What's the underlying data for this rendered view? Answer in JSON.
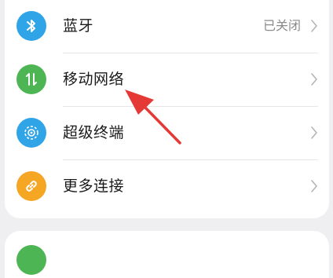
{
  "settings": {
    "items": [
      {
        "label": "蓝牙",
        "value": "已关闭",
        "icon": "bluetooth-icon",
        "color": "#2fa5e8"
      },
      {
        "label": "移动网络",
        "value": "",
        "icon": "mobile-data-icon",
        "color": "#4db553"
      },
      {
        "label": "超级终端",
        "value": "",
        "icon": "super-device-icon",
        "color": "#2fa5e8"
      },
      {
        "label": "更多连接",
        "value": "",
        "icon": "link-icon",
        "color": "#f5a623"
      }
    ],
    "next_card_icon_color": "#4db553"
  },
  "annotation": {
    "arrow_color": "#e53935"
  }
}
